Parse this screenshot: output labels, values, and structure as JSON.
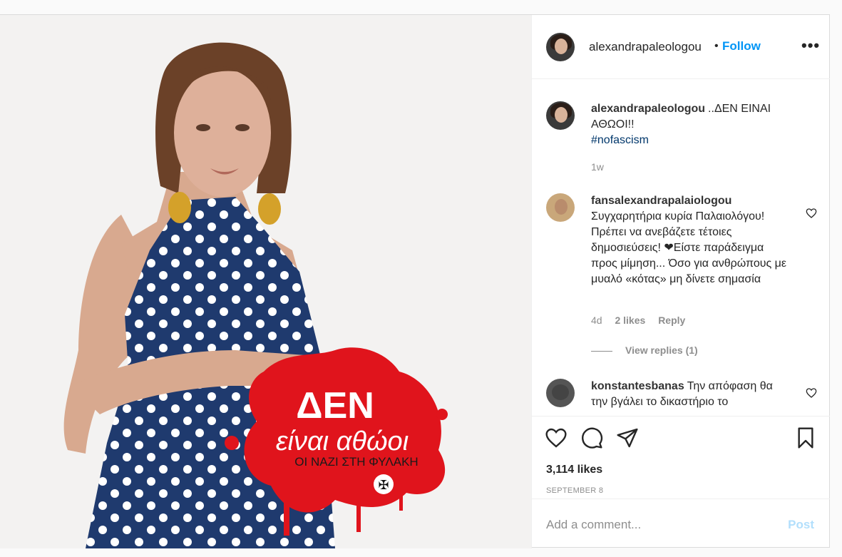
{
  "post": {
    "author": "alexandrapaleologou",
    "separator": "•",
    "follow_label": "Follow",
    "more_label": "•••",
    "caption": {
      "username": "alexandrapaleologou",
      "text": "..ΔΕΝ ΕΙΝΑΙ ΑΘΩΟΙ!!",
      "hashtag": "#nofascism",
      "age": "1w"
    },
    "comments": [
      {
        "username": "fansalexandrapalaiologou",
        "text": "Συγχαρητήρια κυρία Παλαιολόγου! Πρέπει να ανεβάζετε τέτοιες δημοσιεύσεις! ❤Είστε παράδειγμα προς μίμηση... Όσο για ανθρώπους με μυαλό «κότας» μη δίνετε σημασία",
        "age": "4d",
        "likes": "2 likes",
        "reply_label": "Reply",
        "view_replies": "View replies (1)"
      },
      {
        "username": "konstantesbanas",
        "text": "Την απόφαση θα την βγάλει το δικαστήριο το"
      }
    ],
    "likes": "3,114 likes",
    "date": "SEPTEMBER 8",
    "add_comment_placeholder": "Add a comment...",
    "post_label": "Post",
    "image_overlay": {
      "line1": "ΔΕΝ",
      "line2": "είναι αθώοι",
      "line3": "ΟΙ ΝΑΖΙ ΣΤΗ ΦΥΛΑΚΗ"
    }
  },
  "colors": {
    "accent": "#0095f6",
    "post_disabled": "#b2dffc",
    "dress": "#1f3a6e",
    "blood_red": "#e0141c",
    "muted": "#8e8e8e"
  },
  "icons": [
    "heart-icon",
    "comment-icon",
    "share-icon",
    "bookmark-icon",
    "more-icon"
  ]
}
